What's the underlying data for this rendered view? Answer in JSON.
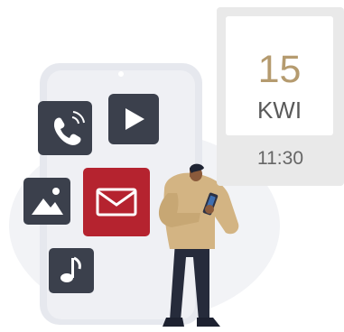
{
  "date_card": {
    "day": "15",
    "month": "KWI",
    "time": "11:30"
  },
  "icons": {
    "phone": "phone-icon",
    "play": "play-icon",
    "image": "image-icon",
    "mail": "mail-icon",
    "music": "music-note-icon"
  },
  "colors": {
    "day_accent": "#b59b6f",
    "tile_dark": "#3b404c",
    "tile_highlight": "#b5232f"
  }
}
